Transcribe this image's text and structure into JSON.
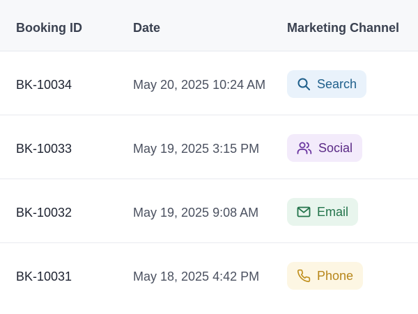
{
  "headers": {
    "booking_id": "Booking ID",
    "date": "Date",
    "channel": "Marketing Channel"
  },
  "rows": [
    {
      "booking_id": "BK-10034",
      "date": "May 20, 2025 10:24 AM",
      "channel": {
        "label": "Search",
        "icon": "search-icon",
        "text_color": "#1f5f8b",
        "bg_color": "#e9f2fb",
        "icon_color": "#1f5f8b"
      }
    },
    {
      "booking_id": "BK-10033",
      "date": "May 19, 2025 3:15 PM",
      "channel": {
        "label": "Social",
        "icon": "users-icon",
        "text_color": "#5b2a86",
        "bg_color": "#f3ebfb",
        "icon_color": "#6a35a0"
      }
    },
    {
      "booking_id": "BK-10032",
      "date": "May 19, 2025 9:08 AM",
      "channel": {
        "label": "Email",
        "icon": "mail-icon",
        "text_color": "#22734a",
        "bg_color": "#e8f5ed",
        "icon_color": "#22734a"
      }
    },
    {
      "booking_id": "BK-10031",
      "date": "May 18, 2025 4:42 PM",
      "channel": {
        "label": "Phone",
        "icon": "phone-icon",
        "text_color": "#b7861a",
        "bg_color": "#fdf6e3",
        "icon_color": "#c08f1c"
      }
    }
  ]
}
